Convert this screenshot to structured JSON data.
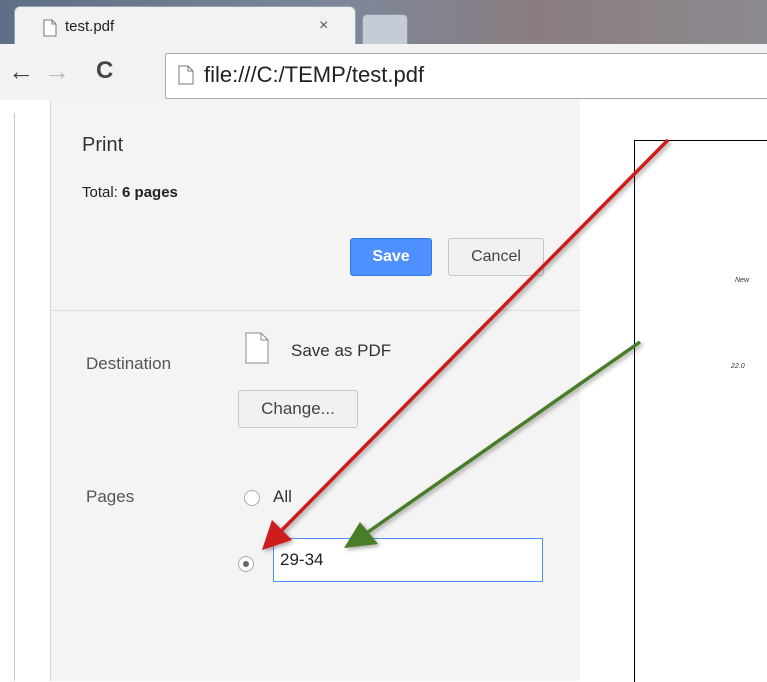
{
  "tab": {
    "title": "test.pdf",
    "close": "×"
  },
  "nav": {
    "back": "←",
    "forward": "→",
    "reload": "C"
  },
  "omnibox": {
    "url": "file:///C:/TEMP/test.pdf"
  },
  "print": {
    "title": "Print",
    "total_label": "Total:",
    "total_value": "6 pages",
    "save_label": "Save",
    "cancel_label": "Cancel",
    "destination_label": "Destination",
    "destination_name": "Save as PDF",
    "change_label": "Change...",
    "pages_label": "Pages",
    "all_label": "All",
    "pages_value": "29-34",
    "selected_option": "custom"
  },
  "annotations": {
    "red_arrow_color": "#cc1a1a",
    "green_arrow_color": "#4a7d2a"
  },
  "preview": {
    "mark_text": "New",
    "mark_number": "22.0"
  }
}
